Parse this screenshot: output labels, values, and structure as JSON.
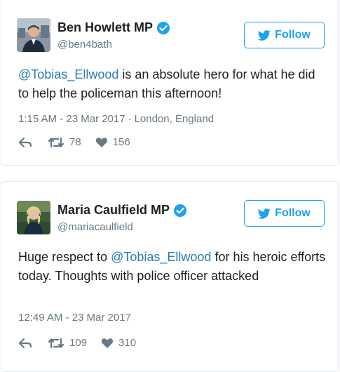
{
  "colors": {
    "accent": "#1da1f2",
    "mention": "#2b7bb9",
    "muted": "#697882",
    "text": "#1c2022",
    "border": "#e1e8ed"
  },
  "tweets": [
    {
      "name": "Ben Howlett MP",
      "handle": "@ben4bath",
      "verified_icon": "verified-badge-icon",
      "follow_label": "Follow",
      "mention": "@Tobias_Ellwood",
      "text_after": " is an absolute hero for what he did to help the policeman this afternoon!",
      "timestamp": "1:15 AM - 23 Mar 2017",
      "separator": "·",
      "location": "London, England",
      "retweets": "78",
      "likes": "156"
    },
    {
      "name": "Maria Caulfield MP",
      "handle": "@mariacaulfield",
      "verified_icon": "verified-badge-icon",
      "follow_label": "Follow",
      "text_before": "Huge respect to ",
      "mention": "@Tobias_Ellwood",
      "text_after": " for his heroic efforts today. Thoughts with police officer attacked",
      "timestamp": "12:49 AM - 23 Mar 2017",
      "retweets": "109",
      "likes": "310"
    }
  ]
}
